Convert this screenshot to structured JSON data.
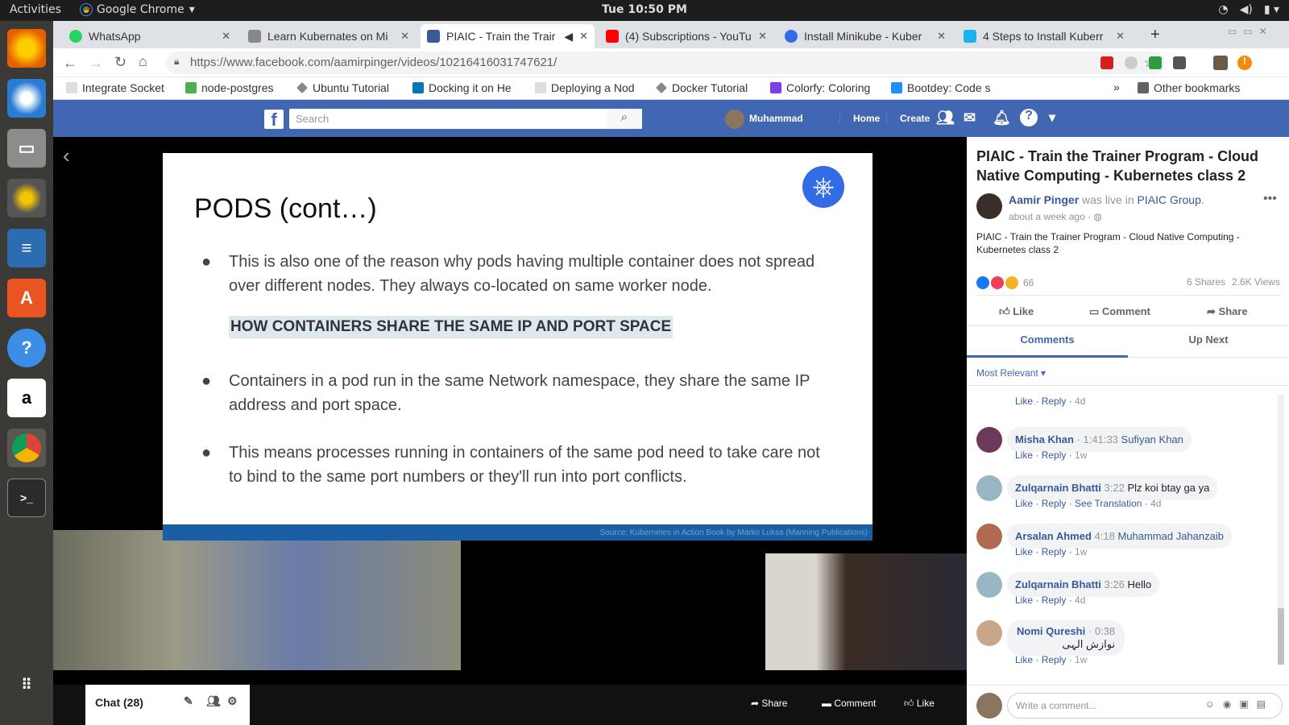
{
  "system": {
    "activities": "Activities",
    "app_name": "Google Chrome",
    "clock": "Tue 10:50 PM"
  },
  "tabs": [
    {
      "label": "WhatsApp",
      "color": "#25d366"
    },
    {
      "label": "Learn Kubernates on Mi",
      "color": "#888888"
    },
    {
      "label": "PIAIC - Train the Trair",
      "color": "#3b5998"
    },
    {
      "label": "(4) Subscriptions - YouTu",
      "color": "#ff0000"
    },
    {
      "label": "Install Minikube - Kuber",
      "color": "#326ce5"
    },
    {
      "label": "4 Steps to Install Kuberr",
      "color": "#18b4f0"
    }
  ],
  "url": {
    "prefix": "https://www.facebook.com",
    "path": "/aamirpinger/videos/10216416031747621/"
  },
  "bookmarks": [
    {
      "label": "Integrate Socket",
      "color": "#dddddd"
    },
    {
      "label": "node-postgres",
      "color": "#4caf50"
    },
    {
      "label": "Ubuntu Tutorial",
      "color": "#888888"
    },
    {
      "label": "Docking it on He",
      "color": "#0077b5"
    },
    {
      "label": "Deploying a Nod",
      "color": "#dddddd"
    },
    {
      "label": "Docker Tutorial",
      "color": "#888888"
    },
    {
      "label": "Colorfy: Coloring",
      "color": "#7b3fe4"
    },
    {
      "label": "Bootdey: Code s",
      "color": "#1e90ff"
    }
  ],
  "other_bookmarks": "Other bookmarks",
  "fb": {
    "search_placeholder": "Search",
    "user": "Muhammad",
    "home": "Home",
    "create": "Create"
  },
  "slide": {
    "title": "PODS (cont…)",
    "bullet1": "This is also one of the reason why pods having multiple container does not spread over different nodes. They always co-located on same worker node.",
    "heading": "HOW CONTAINERS SHARE THE SAME IP AND PORT SPACE",
    "bullet2": "Containers in a pod run in the same Network namespace, they share the same IP address and port space.",
    "bullet3": "This means processes running in containers of the same pod need to take care not to bind to the same port numbers or they'll run into port conflicts.",
    "source": "Source: Kubernetes in Action Book by Marko Luksa (Manning Publications)"
  },
  "player": {
    "chat": "Chat (28)",
    "share": "Share",
    "comment": "Comment",
    "like": "Like"
  },
  "post": {
    "title": "PIAIC - Train the Trainer Program - Cloud Native Computing - Kubernetes class 2",
    "author": "Aamir Pinger",
    "was_live": "was live in",
    "group": "PIAIC Group",
    "time": "about a week ago ·",
    "description": "PIAIC - Train the Trainer Program - Cloud Native Computing - Kubernetes class 2",
    "reactions": "66",
    "shares": "6 Shares",
    "views": "2.6K Views",
    "like": "Like",
    "comment": "Comment",
    "share": "Share",
    "tab_comments": "Comments",
    "tab_upnext": "Up Next",
    "sort": "Most Relevant",
    "write_placeholder": "Write a comment..."
  },
  "actions": {
    "like": "Like",
    "reply": "Reply",
    "see_translation": "See Translation"
  },
  "comments": [
    {
      "name": "Misha Khan",
      "ts": "· 1:41:33",
      "text": "Sufiyan Khan",
      "link": true,
      "age": "1w",
      "translation": false,
      "avatar": "#6b3a5a"
    },
    {
      "name": "Zulqarnain Bhatti",
      "ts": "3:22",
      "text": "Plz koi btay ga ya",
      "link": false,
      "age": "4d",
      "translation": true,
      "avatar": "#9ab5c4"
    },
    {
      "name": "Arsalan Ahmed",
      "ts": "4:18",
      "text": "Muhammad Jahanzaib",
      "link": true,
      "age": "1w",
      "translation": false,
      "avatar": "#b06a52"
    },
    {
      "name": "Zulqarnain Bhatti",
      "ts": "3:26",
      "text": "Hello",
      "link": false,
      "age": "4d",
      "translation": false,
      "avatar": "#9ab5c4"
    },
    {
      "name": "Nomi Qureshi",
      "ts": "· 0:38",
      "text": "نوازش الہی",
      "link": false,
      "age": "1w",
      "translation": false,
      "avatar": "#c9a68a"
    }
  ],
  "prev_comment_age": "4d"
}
